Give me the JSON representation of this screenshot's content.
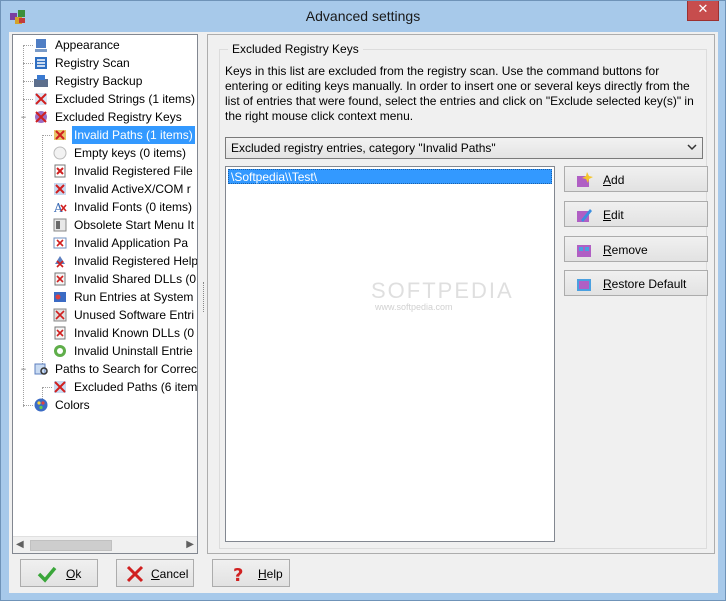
{
  "window": {
    "title": "Advanced settings",
    "close_glyph": "✕"
  },
  "tree": {
    "items": [
      {
        "label": "Appearance",
        "icon": "appearance-icon"
      },
      {
        "label": "Registry Scan",
        "icon": "registry-scan-icon"
      },
      {
        "label": "Registry Backup",
        "icon": "registry-backup-icon"
      },
      {
        "label": "Excluded Strings (1 items)",
        "icon": "excluded-strings-icon"
      },
      {
        "label": "Excluded Registry Keys",
        "icon": "excluded-keys-icon"
      },
      {
        "label": "Invalid Paths (1 items)",
        "icon": "invalid-paths-icon"
      },
      {
        "label": "Empty keys (0 items)",
        "icon": "empty-keys-icon"
      },
      {
        "label": "Invalid Registered File",
        "icon": "registered-file-icon"
      },
      {
        "label": "Invalid ActiveX/COM r",
        "icon": "activex-icon"
      },
      {
        "label": "Invalid Fonts (0 items)",
        "icon": "fonts-icon"
      },
      {
        "label": "Obsolete Start Menu It",
        "icon": "start-menu-icon"
      },
      {
        "label": "Invalid Application Pa",
        "icon": "application-paths-icon"
      },
      {
        "label": "Invalid Registered Help",
        "icon": "help-files-icon"
      },
      {
        "label": "Invalid Shared DLLs (0",
        "icon": "shared-dlls-icon"
      },
      {
        "label": "Run Entries at System",
        "icon": "run-entries-icon"
      },
      {
        "label": "Unused Software Entri",
        "icon": "software-entries-icon"
      },
      {
        "label": "Invalid Known DLLs (0",
        "icon": "known-dlls-icon"
      },
      {
        "label": "Invalid Uninstall Entrie",
        "icon": "uninstall-icon"
      },
      {
        "label": "Paths to Search for Correc",
        "icon": "search-paths-icon"
      },
      {
        "label": "Excluded Paths (6 item",
        "icon": "excluded-paths-icon"
      },
      {
        "label": "Colors",
        "icon": "colors-icon"
      }
    ],
    "expander_minus": "−"
  },
  "panel": {
    "group_title": "Excluded Registry Keys",
    "description": "Keys in this list are excluded from the registry scan. Use the command buttons for entering or editing keys manually. In order to insert one or several keys directly from the list of entries that were found, select the entries and click on \"Exclude selected key(s)\" in the right mouse click context menu.",
    "category_selected": "Excluded registry entries, category \"Invalid Paths\"",
    "list_items": [
      "\\Softpedia\\\\Test\\"
    ],
    "buttons": {
      "add": "Add",
      "edit": "Edit",
      "remove": "Remove",
      "restore": "Restore Default"
    }
  },
  "footer": {
    "ok": "Ok",
    "cancel": "Cancel",
    "help": "Help"
  },
  "watermark": {
    "main": "SOFTPEDIA",
    "sub": "www.softpedia.com"
  }
}
